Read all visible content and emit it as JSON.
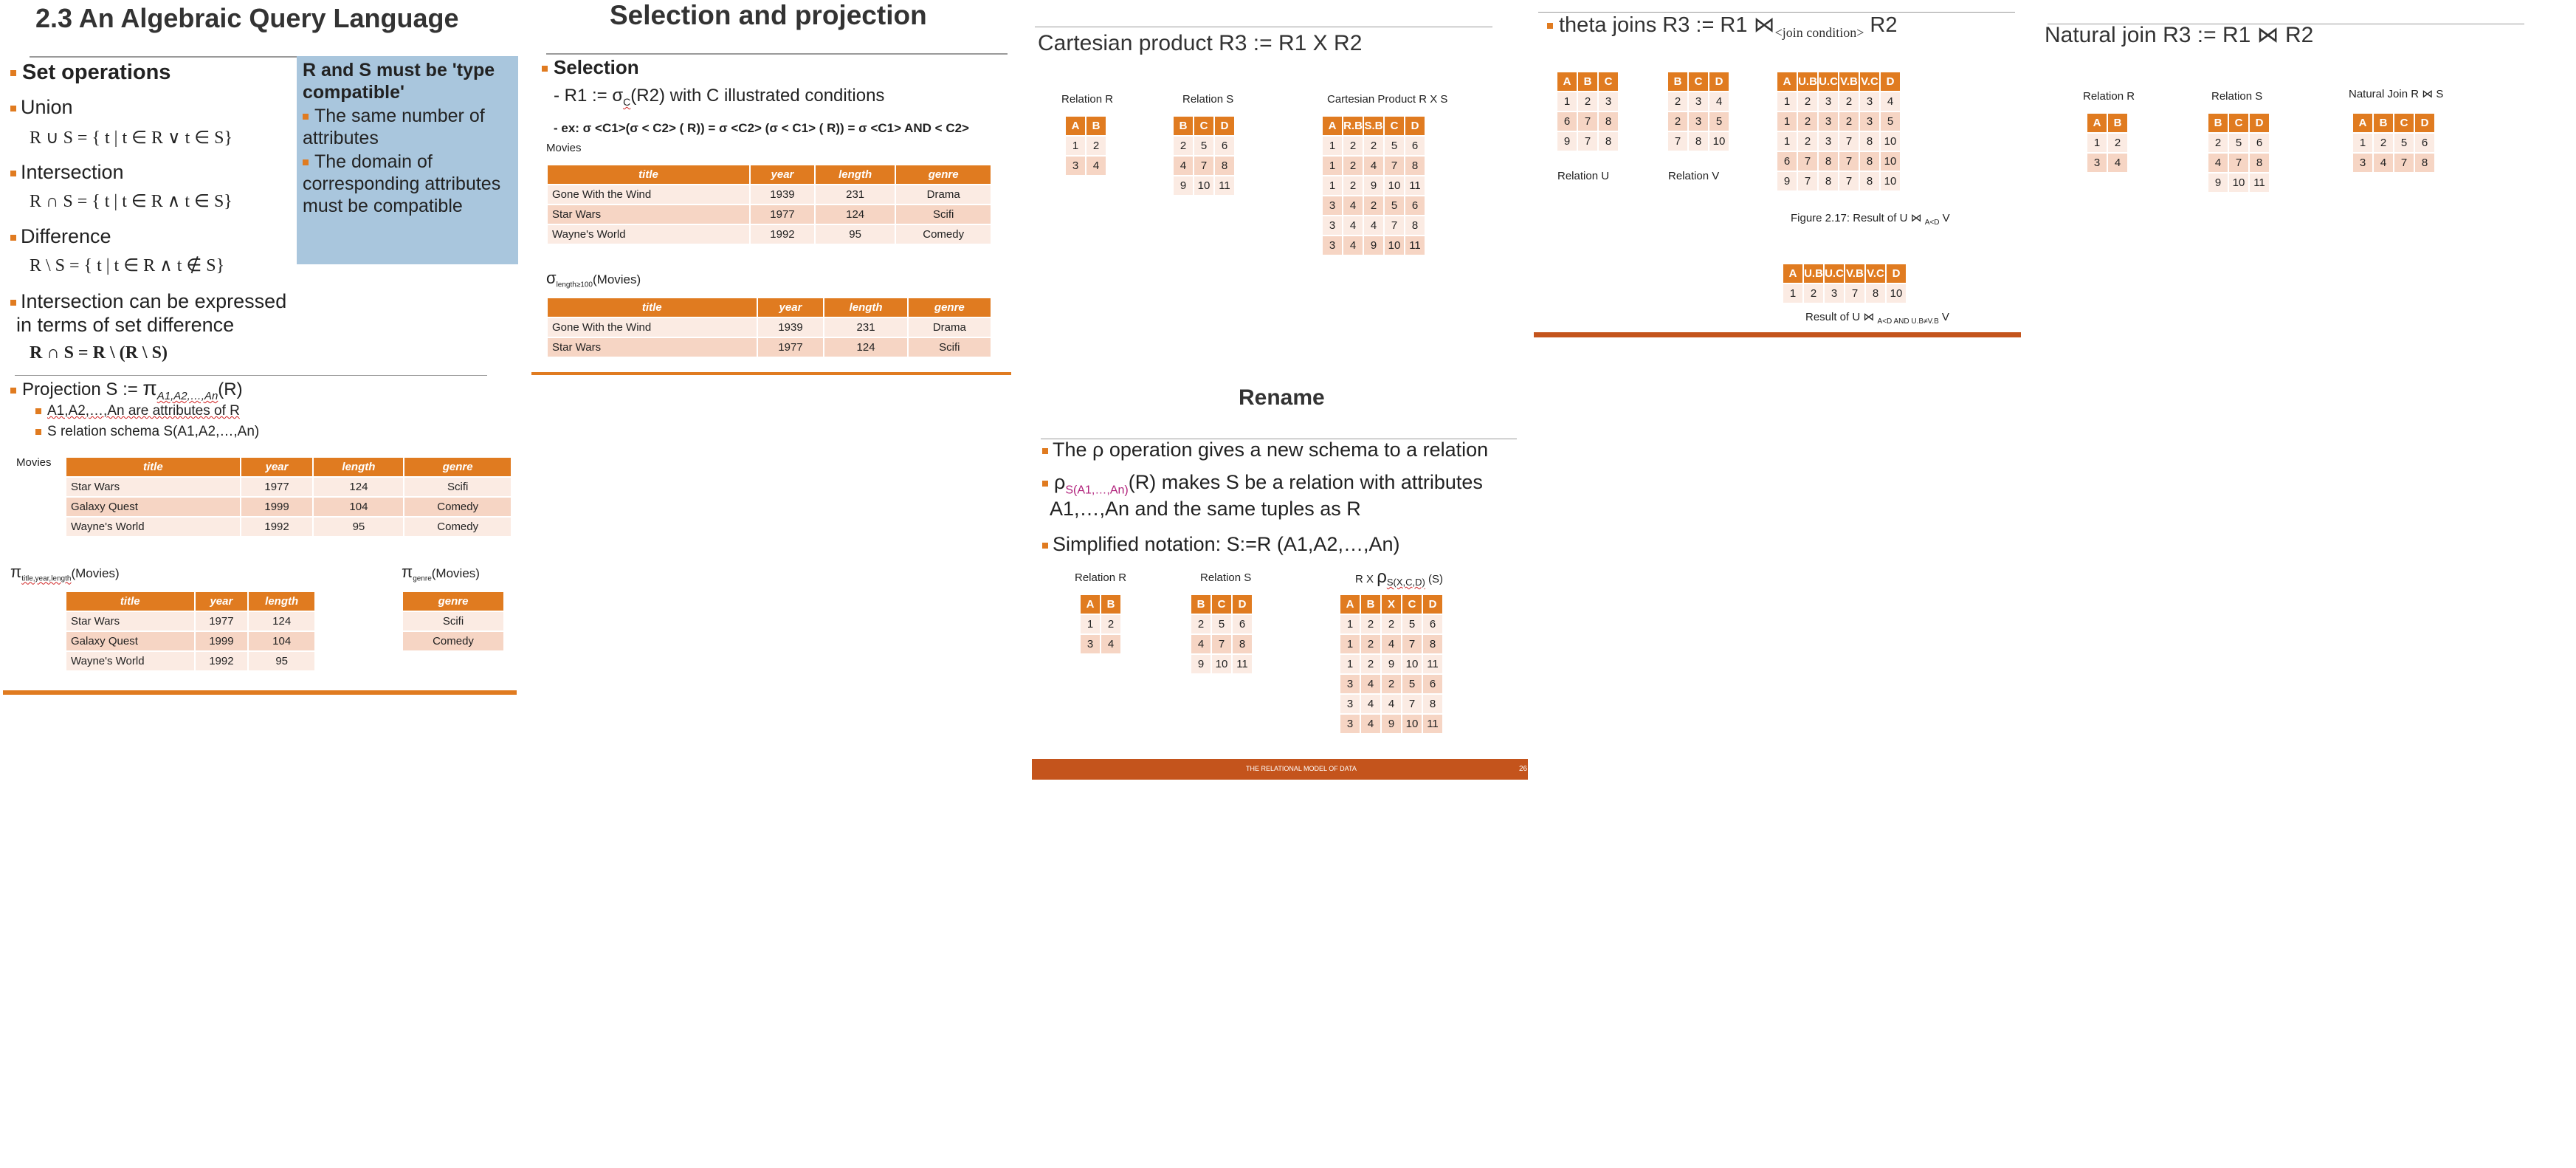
{
  "slide1": {
    "title": "2.3 An Algebraic Query Language",
    "set_ops_heading": "Set operations",
    "union_label": "Union",
    "union_formula": "R ∪ S = { t | t ∈ R ∨ t ∈ S}",
    "intersection_label": "Intersection",
    "intersection_formula": "R ∩ S = { t | t ∈ R ∧ t ∈ S}",
    "difference_label": "Difference",
    "difference_formula": "R \\ S = { t | t ∈ R ∧ t ∉ S}",
    "intersect_expr_line1": "Intersection can be expressed",
    "intersect_expr_line2": "in terms of set difference",
    "intersect_expr_formula": "R ∩ S = R \\ (R \\ S)",
    "box_title": "R and S must be 'type compatible'",
    "box_items": [
      "The same number of attributes",
      "The domain of corresponding attributes must be compatible"
    ],
    "projection_prefix": "Projection S := ",
    "projection_pi": "π",
    "projection_sub": "A1,A2,…,An",
    "projection_suffix": "(R)",
    "proj_sub1": "A1,A2,…,An are attributes of R",
    "proj_sub2": "S relation schema S(A1,A2,…,An)",
    "movies_label": "Movies",
    "movies_headers": [
      "title",
      "year",
      "length",
      "genre"
    ],
    "movies_rows": [
      [
        "Star Wars",
        "1977",
        "124",
        "Scifi"
      ],
      [
        "Galaxy Quest",
        "1999",
        "104",
        "Comedy"
      ],
      [
        "Wayne's World",
        "1992",
        "95",
        "Comedy"
      ]
    ],
    "pi1_symbol": "π",
    "pi1_sub": "title,year,length",
    "pi1_suffix": "(Movies)",
    "pi1_headers": [
      "title",
      "year",
      "length"
    ],
    "pi1_rows": [
      [
        "Star Wars",
        "1977",
        "124"
      ],
      [
        "Galaxy Quest",
        "1999",
        "104"
      ],
      [
        "Wayne's World",
        "1992",
        "95"
      ]
    ],
    "pi2_symbol": "π",
    "pi2_sub": "genre",
    "pi2_suffix": "(Movies)",
    "pi2_headers": [
      "genre"
    ],
    "pi2_rows": [
      [
        "Scifi"
      ],
      [
        "Comedy"
      ]
    ]
  },
  "slide2": {
    "title": "Selection and projection",
    "selection_heading": "Selection",
    "sel_def_prefix": "- R1 := ",
    "sel_def_sigma": "σ",
    "sel_def_sub": "C",
    "sel_def_suffix": "(R2) with C illustrated conditions",
    "example_text": "- ex: σ <C1>(σ < C2> ( R)) = σ <C2> (σ < C1> ( R)) = σ <C1> AND < C2>",
    "movies_label": "Movies",
    "movies_headers": [
      "title",
      "year",
      "length",
      "genre"
    ],
    "movies_rows": [
      [
        "Gone With the Wind",
        "1939",
        "231",
        "Drama"
      ],
      [
        "Star Wars",
        "1977",
        "124",
        "Scifi"
      ],
      [
        "Wayne's World",
        "1992",
        "95",
        "Comedy"
      ]
    ],
    "sel_symbol": "σ",
    "sel_sub": "length≥100",
    "sel_suffix": "(Movies)",
    "sel_rows": [
      [
        "Gone With the Wind",
        "1939",
        "231",
        "Drama"
      ],
      [
        "Star Wars",
        "1977",
        "124",
        "Scifi"
      ]
    ]
  },
  "slide3": {
    "title": "Cartesian product  R3 := R1 X R2",
    "relR_label": "Relation R",
    "relR_headers": [
      "A",
      "B"
    ],
    "relR_rows": [
      [
        "1",
        "2"
      ],
      [
        "3",
        "4"
      ]
    ],
    "relS_label": "Relation S",
    "relS_headers": [
      "B",
      "C",
      "D"
    ],
    "relS_rows": [
      [
        "2",
        "5",
        "6"
      ],
      [
        "4",
        "7",
        "8"
      ],
      [
        "9",
        "10",
        "11"
      ]
    ],
    "prod_label": "Cartesian Product R X S",
    "prod_headers": [
      "A",
      "R.B",
      "S.B",
      "C",
      "D"
    ],
    "prod_rows": [
      [
        "1",
        "2",
        "2",
        "5",
        "6"
      ],
      [
        "1",
        "2",
        "4",
        "7",
        "8"
      ],
      [
        "1",
        "2",
        "9",
        "10",
        "11"
      ],
      [
        "3",
        "4",
        "2",
        "5",
        "6"
      ],
      [
        "3",
        "4",
        "4",
        "7",
        "8"
      ],
      [
        "3",
        "4",
        "9",
        "10",
        "11"
      ]
    ]
  },
  "slide4": {
    "title": "theta joins R3 := R1 ⋈",
    "title_sub": "<join condition>",
    "title_end": " R2",
    "relU_label": "Relation U",
    "relU_headers": [
      "A",
      "B",
      "C"
    ],
    "relU_rows": [
      [
        "1",
        "2",
        "3"
      ],
      [
        "6",
        "7",
        "8"
      ],
      [
        "9",
        "7",
        "8"
      ]
    ],
    "relV_label": "Relation V",
    "relV_headers": [
      "B",
      "C",
      "D"
    ],
    "relV_rows": [
      [
        "2",
        "3",
        "4"
      ],
      [
        "2",
        "3",
        "5"
      ],
      [
        "7",
        "8",
        "10"
      ]
    ],
    "join_headers": [
      "A",
      "U.B",
      "U.C",
      "V.B",
      "V.C",
      "D"
    ],
    "join_rows": [
      [
        "1",
        "2",
        "3",
        "2",
        "3",
        "4"
      ],
      [
        "1",
        "2",
        "3",
        "2",
        "3",
        "5"
      ],
      [
        "1",
        "2",
        "3",
        "7",
        "8",
        "10"
      ],
      [
        "6",
        "7",
        "8",
        "7",
        "8",
        "10"
      ],
      [
        "9",
        "7",
        "8",
        "7",
        "8",
        "10"
      ]
    ],
    "fig_caption": "Figure 2.17: Result of U ⋈ ",
    "fig_caption_sub": "A<D",
    "fig_caption_end": " V",
    "join2_headers": [
      "A",
      "U.B",
      "U.C",
      "V.B",
      "V.C",
      "D"
    ],
    "join2_rows": [
      [
        "1",
        "2",
        "3",
        "7",
        "8",
        "10"
      ]
    ],
    "result_caption": "Result of U ⋈ ",
    "result_caption_sub": "A<D AND U.B≠V.B",
    "result_caption_end": " V"
  },
  "slide5": {
    "title": "Natural join R3 := R1 ⋈ R2",
    "relR_label": "Relation R",
    "relR_headers": [
      "A",
      "B"
    ],
    "relR_rows": [
      [
        "1",
        "2"
      ],
      [
        "3",
        "4"
      ]
    ],
    "relS_label": "Relation S",
    "relS_headers": [
      "B",
      "C",
      "D"
    ],
    "relS_rows": [
      [
        "2",
        "5",
        "6"
      ],
      [
        "4",
        "7",
        "8"
      ],
      [
        "9",
        "10",
        "11"
      ]
    ],
    "nat_label": "Natural Join R ⋈ S",
    "nat_headers": [
      "A",
      "B",
      "C",
      "D"
    ],
    "nat_rows": [
      [
        "1",
        "2",
        "5",
        "6"
      ],
      [
        "3",
        "4",
        "7",
        "8"
      ]
    ]
  },
  "slide6": {
    "title": "Rename",
    "b1": "The ρ operation gives a new schema to a relation",
    "b2_rho": "ρ",
    "b2_sub": "S(A1,…,An)",
    "b2_rest": "(R) makes S be a relation with attributes",
    "b2_line2": "A1,…,An  and the same tuples as R",
    "b3": "Simplified notation: S:=R (A1,A2,…,An)",
    "relR_label": "Relation R",
    "relR_headers": [
      "A",
      "B"
    ],
    "relR_rows": [
      [
        "1",
        "2"
      ],
      [
        "3",
        "4"
      ]
    ],
    "relS_label": "Relation S",
    "relS_headers": [
      "B",
      "C",
      "D"
    ],
    "relS_rows": [
      [
        "2",
        "5",
        "6"
      ],
      [
        "4",
        "7",
        "8"
      ],
      [
        "9",
        "10",
        "11"
      ]
    ],
    "res_label_prefix": "R X ",
    "res_label_rho": "ρ",
    "res_label_sub": "S(X,C,D)",
    "res_label_suffix": " (S)",
    "res_headers": [
      "A",
      "B",
      "X",
      "C",
      "D"
    ],
    "res_rows": [
      [
        "1",
        "2",
        "2",
        "5",
        "6"
      ],
      [
        "1",
        "2",
        "4",
        "7",
        "8"
      ],
      [
        "1",
        "2",
        "9",
        "10",
        "11"
      ],
      [
        "3",
        "4",
        "2",
        "5",
        "6"
      ],
      [
        "3",
        "4",
        "4",
        "7",
        "8"
      ],
      [
        "3",
        "4",
        "9",
        "10",
        "11"
      ]
    ],
    "footer_text": "THE RELATIONAL MODEL OF DATA",
    "page_number": "26"
  },
  "colors": {
    "accent": "#e07b20",
    "box": "#a9c6dd",
    "footer": "#c4541c"
  }
}
